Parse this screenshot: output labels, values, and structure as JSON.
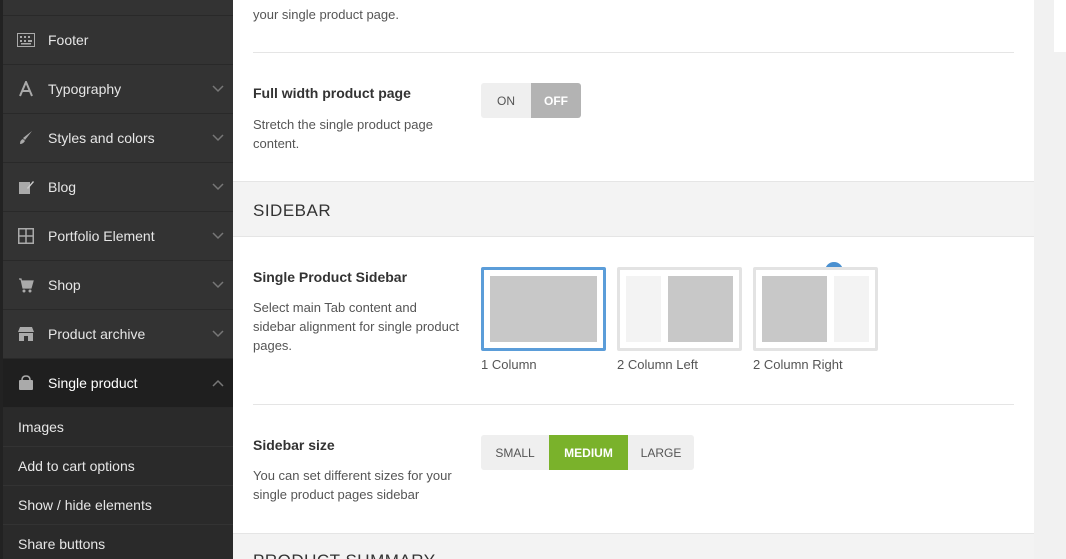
{
  "sidebar": {
    "items": [
      {
        "label": "Footer",
        "icon": "keyboard-icon"
      },
      {
        "label": "Typography",
        "icon": "font-icon"
      },
      {
        "label": "Styles and colors",
        "icon": "brush-icon"
      },
      {
        "label": "Blog",
        "icon": "edit-icon"
      },
      {
        "label": "Portfolio Element",
        "icon": "grid-icon"
      },
      {
        "label": "Shop",
        "icon": "cart-icon"
      },
      {
        "label": "Product archive",
        "icon": "store-icon"
      },
      {
        "label": "Single product",
        "icon": "bag-icon"
      }
    ],
    "subitems": [
      {
        "label": "Images"
      },
      {
        "label": "Add to cart options"
      },
      {
        "label": "Show / hide elements"
      },
      {
        "label": "Share buttons"
      }
    ]
  },
  "content": {
    "top_text": "your single product page.",
    "full_width": {
      "title": "Full width product page",
      "desc": "Stretch the single product page content.",
      "on_label": "ON",
      "off_label": "OFF"
    },
    "section_title": "SIDEBAR",
    "product_sidebar": {
      "title": "Single Product Sidebar",
      "desc": "Select main Tab content and sidebar alignment for single product pages.",
      "options": [
        {
          "label": "1 Column"
        },
        {
          "label": "2 Column Left"
        },
        {
          "label": "2 Column Right"
        }
      ]
    },
    "sidebar_size": {
      "title": "Sidebar size",
      "desc": "You can set different sizes for your single product pages sidebar",
      "options": [
        "SMALL",
        "MEDIUM",
        "LARGE"
      ]
    },
    "next_section_title": "PRODUCT SUMMARY"
  },
  "colors": {
    "sidebar_bg": "#333333",
    "active_item_bg": "#1f1f1f",
    "selected_border": "#5b9dd9",
    "accent_green": "#7ab22b"
  }
}
